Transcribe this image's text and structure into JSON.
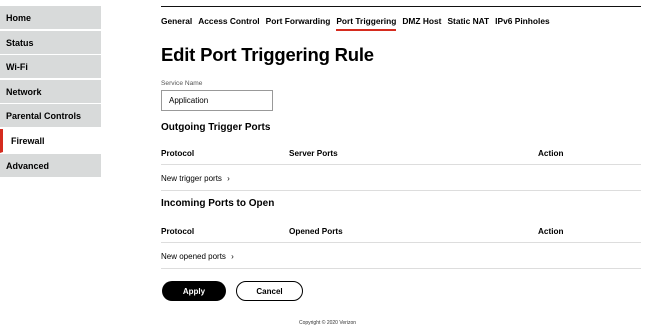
{
  "sidebar": {
    "items": [
      {
        "label": "Home"
      },
      {
        "label": "Status"
      },
      {
        "label": "Wi-Fi"
      },
      {
        "label": "Network"
      },
      {
        "label": "Parental Controls"
      },
      {
        "label": "Firewall"
      },
      {
        "label": "Advanced"
      }
    ],
    "active": "Firewall"
  },
  "tabs": [
    {
      "label": "General"
    },
    {
      "label": "Access Control"
    },
    {
      "label": "Port Forwarding"
    },
    {
      "label": "Port Triggering"
    },
    {
      "label": "DMZ Host"
    },
    {
      "label": "Static NAT"
    },
    {
      "label": "IPv6 Pinholes"
    }
  ],
  "page_title": "Edit Port Triggering Rule",
  "service_name": {
    "label": "Service Name",
    "value": "Application"
  },
  "outgoing": {
    "title": "Outgoing Trigger Ports",
    "columns": {
      "protocol": "Protocol",
      "ports": "Server Ports",
      "action": "Action"
    },
    "new_link": "New trigger ports",
    "chevron": "›"
  },
  "incoming": {
    "title": "Incoming Ports to Open",
    "columns": {
      "protocol": "Protocol",
      "ports": "Opened Ports",
      "action": "Action"
    },
    "new_link": "New opened ports",
    "chevron": "›"
  },
  "buttons": {
    "apply": "Apply",
    "cancel": "Cancel"
  },
  "footer": "Copyright © 2020 Verizon",
  "colors": {
    "accent": "#d52b1e",
    "sidebar_bg": "#d8dada"
  }
}
